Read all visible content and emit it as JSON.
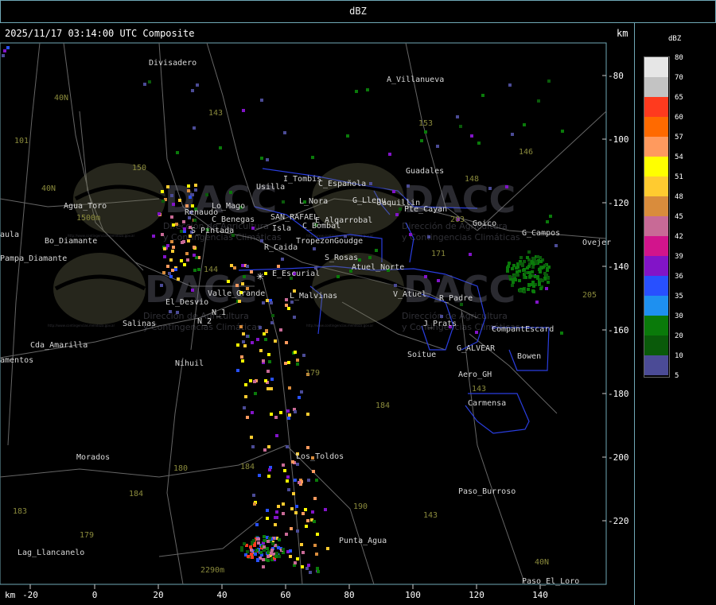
{
  "top_title": "dBZ",
  "header": {
    "timestamp": "2025/11/17 03:14:00 UTC Composite",
    "unit_top": "km"
  },
  "axes": {
    "x_unit": "km",
    "x_ticks": [
      "-20",
      "0",
      "20",
      "40",
      "60",
      "80",
      "100",
      "120",
      "140"
    ],
    "y_ticks": [
      "-80",
      "-100",
      "-120",
      "-140",
      "-160",
      "-180",
      "-200",
      "-220"
    ]
  },
  "legend": {
    "title": "dBZ",
    "entries": [
      {
        "label": "80",
        "color": "#e6e6e6"
      },
      {
        "label": "70",
        "color": "#c3c3c3"
      },
      {
        "label": "65",
        "color": "#ff3a1e"
      },
      {
        "label": "60",
        "color": "#ff6a00"
      },
      {
        "label": "57",
        "color": "#ff9a5e"
      },
      {
        "label": "54",
        "color": "#ffff00"
      },
      {
        "label": "51",
        "color": "#ffcb30"
      },
      {
        "label": "48",
        "color": "#d98c3c"
      },
      {
        "label": "45",
        "color": "#c86a96"
      },
      {
        "label": "42",
        "color": "#d2148c"
      },
      {
        "label": "39",
        "color": "#8214c8"
      },
      {
        "label": "36",
        "color": "#2850ff"
      },
      {
        "label": "35",
        "color": "#1e90f0"
      },
      {
        "label": "30",
        "color": "#0a7a0a"
      },
      {
        "label": "20",
        "color": "#0a5a0a"
      },
      {
        "label": "10",
        "color": "#4b4b96"
      },
      {
        "label": "5",
        "color": ""
      }
    ]
  },
  "watermark": {
    "brand": "DACC",
    "line1": "Dirección de Agricultura",
    "line2": "y Contingencias Climáticas",
    "url": "http://www.contingencias.mendoza.gov.ar"
  },
  "places": [
    "Divisadero",
    "A_Villanueva",
    "Guadales",
    "Agua_Toro",
    "Renaudo",
    "Lo_Mago",
    "S_Pintada",
    "C_Benegas",
    "SAN_RAFAEL",
    "E_Algarrobal",
    "C_Bombal",
    "Isla",
    "Tropezon",
    "Goudge",
    "R_Caida",
    "S_Rosas",
    "Atuel_Norte",
    "E_Escurial",
    "Valle_Grande",
    "L_Malvinas",
    "El_Desvio",
    "N_1",
    "N_2",
    "Nihuil",
    "Salinas",
    "Cda_Amarilla",
    "Pampa_Diamante",
    "Bo_Diamante",
    "Usilla",
    "I_Tombis",
    "C_Española",
    "L_Nora",
    "G_Llepu",
    "Jaquillin",
    "Pte_Cayan",
    "Goico",
    "G_Campos",
    "Ovejer",
    "V_Atuel",
    "R_Padre",
    "J_Prats",
    "CompantEscard",
    "G_ALVEAR",
    "Soitue",
    "Bowen",
    "Aero_GH",
    "Carmensa",
    "Los_Toldos",
    "Morados",
    "Paso_Burroso",
    "Punta_Agua",
    "Lag_Llancanelo",
    "Paso_El_Loro",
    "aula",
    "amentos"
  ],
  "road_numbers": [
    "40N",
    "101",
    "143",
    "40N",
    "150",
    "153",
    "146",
    "148",
    "203",
    "171",
    "144",
    "205",
    "179",
    "184",
    "180",
    "184",
    "184",
    "183",
    "179",
    "190",
    "143",
    "143",
    "40N"
  ],
  "elevations": [
    "1500m",
    "2290m"
  ]
}
